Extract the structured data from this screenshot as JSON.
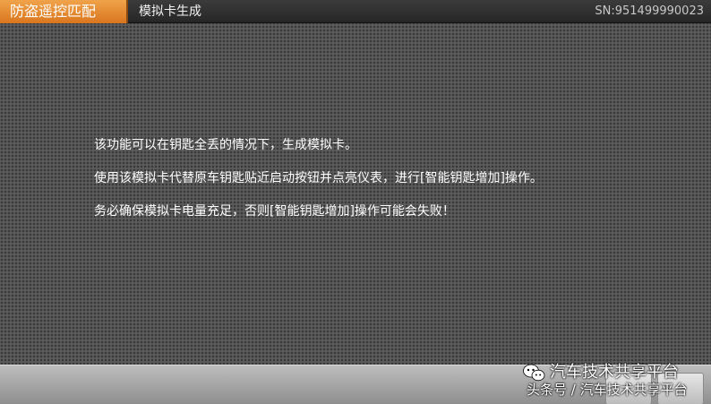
{
  "header": {
    "tab_label": "防盗遥控匹配",
    "title": "模拟卡生成",
    "serial": "SN:951499990023",
    "tab_color": "#e58a2e"
  },
  "message": {
    "lines": [
      "该功能可以在钥匙全丢的情况下，生成模拟卡。",
      "使用该模拟卡代替原车钥匙贴近启动按钮并点亮仪表，进行[智能钥匙增加]操作。",
      "务必确保模拟卡电量充足，否则[智能钥匙增加]操作可能会失败！"
    ]
  },
  "watermark": {
    "line1": "汽车技术共享平台",
    "line2": "头条号 / 汽车技术共享平台",
    "logo_icon": "wechat-icon"
  }
}
